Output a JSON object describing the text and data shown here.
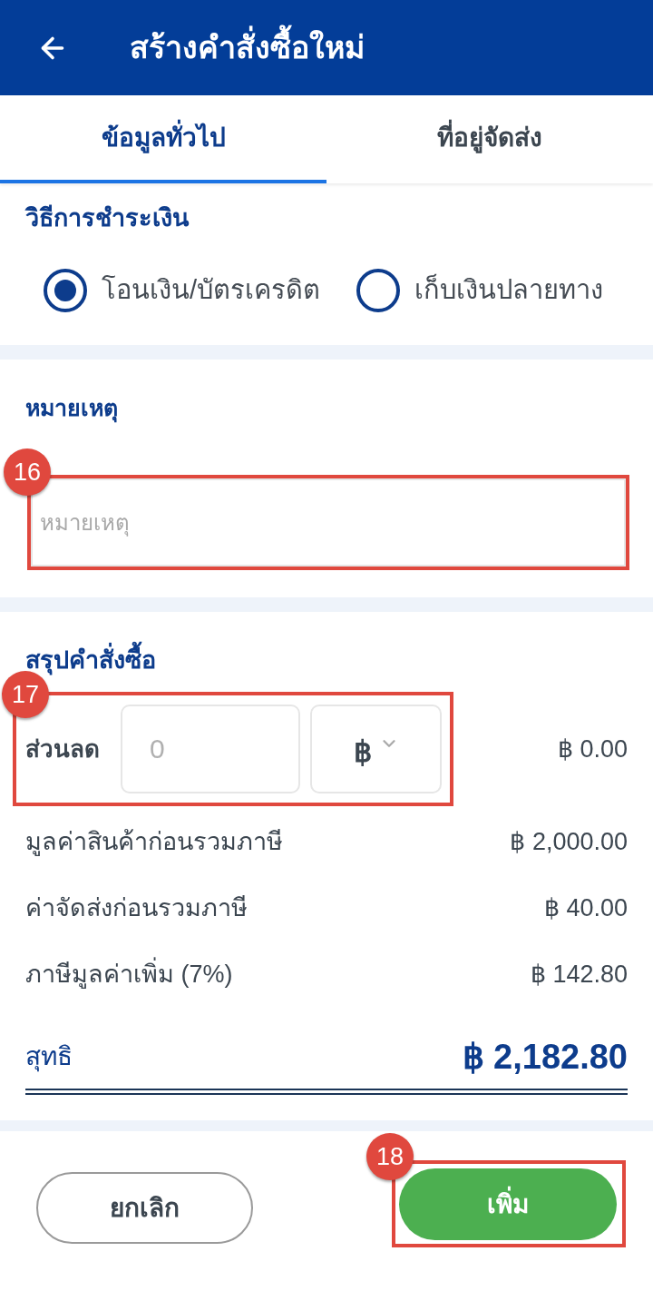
{
  "header": {
    "title": "สร้างคำสั่งซื้อใหม่"
  },
  "tabs": [
    {
      "label": "ข้อมูลทั่วไป",
      "selected": true
    },
    {
      "label": "ที่อยู่จัดส่ง",
      "selected": false
    }
  ],
  "payment": {
    "heading": "วิธีการชำระเงิน",
    "options": [
      {
        "label": "โอนเงิน/บัตรเครดิต",
        "selected": true
      },
      {
        "label": "เก็บเงินปลายทาง",
        "selected": false
      }
    ]
  },
  "remarks": {
    "heading": "หมายเหตุ",
    "placeholder": "หมายเหตุ",
    "callout": "16"
  },
  "summary": {
    "heading": "สรุปคำสั่งซื้อ",
    "discount": {
      "label": "ส่วนลด",
      "placeholder": "0",
      "unit": "฿",
      "amount": "฿ 0.00",
      "callout": "17"
    },
    "rows": [
      {
        "label": "มูลค่าสินค้าก่อนรวมภาษี",
        "amount": "฿ 2,000.00"
      },
      {
        "label": "ค่าจัดส่งก่อนรวมภาษี",
        "amount": "฿ 40.00"
      },
      {
        "label": "ภาษีมูลค่าเพิ่ม (7%)",
        "amount": "฿ 142.80"
      }
    ],
    "total": {
      "label": "สุทธิ",
      "amount": "฿ 2,182.80"
    }
  },
  "actions": [
    {
      "label": "ยกเลิก",
      "kind": "secondary"
    },
    {
      "label": "เพิ่ม",
      "kind": "primary",
      "callout": "18"
    }
  ]
}
